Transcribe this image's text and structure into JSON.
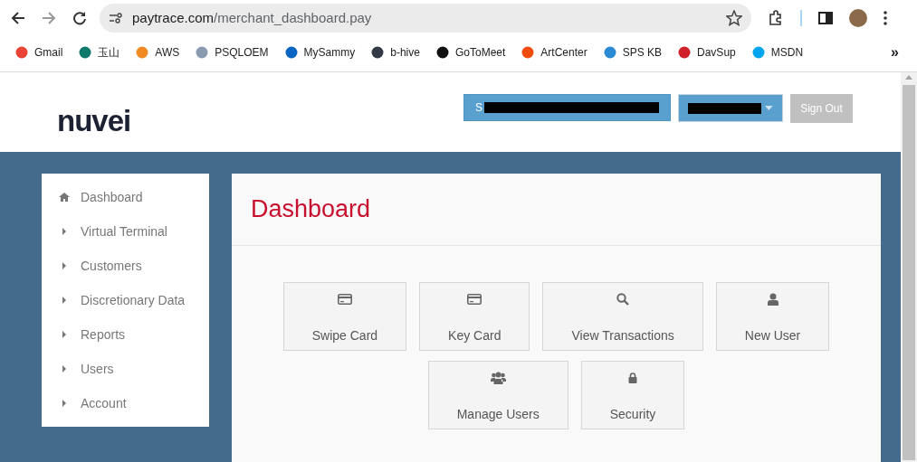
{
  "browser": {
    "url_host": "paytrace.com",
    "url_path": "/merchant_dashboard.pay",
    "bookmarks": [
      {
        "label": "Gmail",
        "color": "#ea4335"
      },
      {
        "label": "玉山",
        "color": "#0f7a6b"
      },
      {
        "label": "AWS",
        "color": "#f08a24"
      },
      {
        "label": "PSQLOEM",
        "color": "#8a9bb0"
      },
      {
        "label": "MySammy",
        "color": "#0a66c2"
      },
      {
        "label": "b-hive",
        "color": "#333a45"
      },
      {
        "label": "GoToMeet",
        "color": "#111111"
      },
      {
        "label": "ArtCenter",
        "color": "#f04a0c"
      },
      {
        "label": "SPS KB",
        "color": "#2a8ad4"
      },
      {
        "label": "DavSup",
        "color": "#d0202a"
      },
      {
        "label": "MSDN",
        "color": "#00a4ef"
      }
    ],
    "overflow": "»"
  },
  "header": {
    "logo": "nuvei",
    "account_button": "S",
    "sign_out": "Sign Out"
  },
  "sidebar": {
    "items": [
      {
        "label": "Dashboard",
        "kind": "home"
      },
      {
        "label": "Virtual Terminal",
        "kind": "caret"
      },
      {
        "label": "Customers",
        "kind": "caret"
      },
      {
        "label": "Discretionary Data",
        "kind": "caret"
      },
      {
        "label": "Reports",
        "kind": "caret"
      },
      {
        "label": "Users",
        "kind": "caret"
      },
      {
        "label": "Account",
        "kind": "caret"
      }
    ]
  },
  "main": {
    "title": "Dashboard",
    "tiles": [
      {
        "label": "Swipe Card",
        "kind": "card"
      },
      {
        "label": "Key Card",
        "kind": "card"
      },
      {
        "label": "View Transactions",
        "kind": "search"
      },
      {
        "label": "New User",
        "kind": "user"
      },
      {
        "label": "Manage Users",
        "kind": "users"
      },
      {
        "label": "Security",
        "kind": "lock"
      }
    ]
  }
}
